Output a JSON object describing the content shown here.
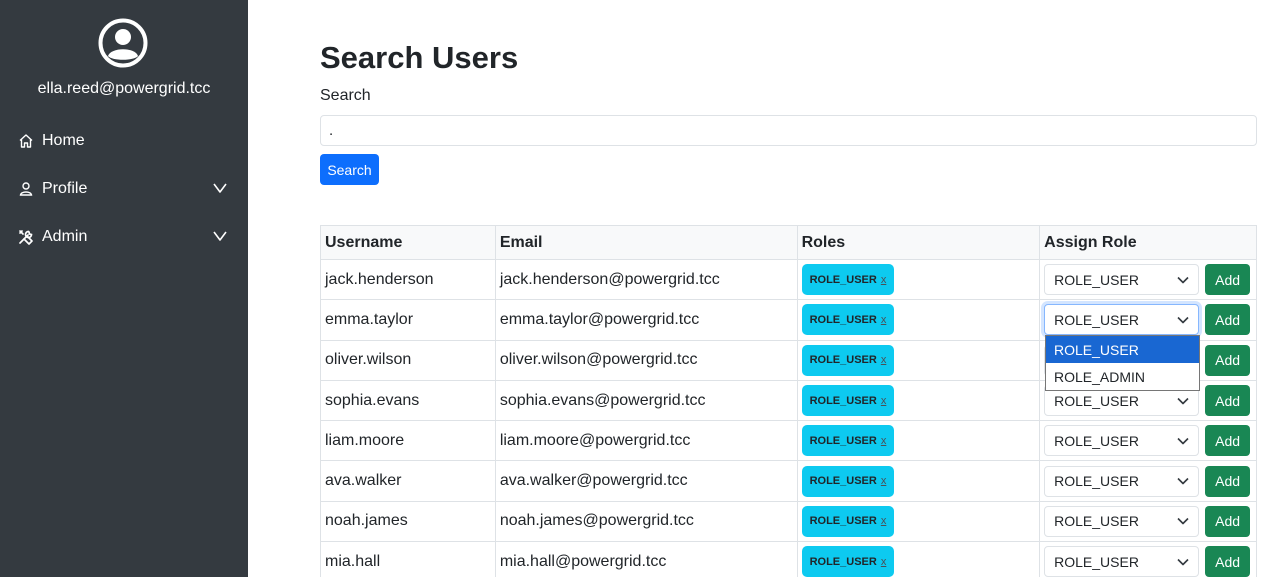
{
  "sidebar": {
    "user_email": "ella.reed@powergrid.tcc",
    "nav": [
      {
        "label": "Home",
        "icon": "home-icon"
      },
      {
        "label": "Profile",
        "icon": "person-icon"
      },
      {
        "label": "Admin",
        "icon": "tools-icon"
      }
    ]
  },
  "main": {
    "title": "Search Users",
    "search_label": "Search",
    "search_value": ".",
    "search_button": "Search"
  },
  "table": {
    "headers": [
      "Username",
      "Email",
      "Roles",
      "Assign Role"
    ],
    "rows": [
      {
        "username": "jack.henderson",
        "email": "jack.henderson@powergrid.tcc",
        "role": "ROLE_USER",
        "remove": "x",
        "select": "ROLE_USER",
        "add": "Add"
      },
      {
        "username": "emma.taylor",
        "email": "emma.taylor@powergrid.tcc",
        "role": "ROLE_USER",
        "remove": "x",
        "select": "ROLE_USER",
        "add": "Add"
      },
      {
        "username": "oliver.wilson",
        "email": "oliver.wilson@powergrid.tcc",
        "role": "ROLE_USER",
        "remove": "x",
        "select": "ROLE_USER",
        "add": "Add"
      },
      {
        "username": "sophia.evans",
        "email": "sophia.evans@powergrid.tcc",
        "role": "ROLE_USER",
        "remove": "x",
        "select": "ROLE_USER",
        "add": "Add"
      },
      {
        "username": "liam.moore",
        "email": "liam.moore@powergrid.tcc",
        "role": "ROLE_USER",
        "remove": "x",
        "select": "ROLE_USER",
        "add": "Add"
      },
      {
        "username": "ava.walker",
        "email": "ava.walker@powergrid.tcc",
        "role": "ROLE_USER",
        "remove": "x",
        "select": "ROLE_USER",
        "add": "Add"
      },
      {
        "username": "noah.james",
        "email": "noah.james@powergrid.tcc",
        "role": "ROLE_USER",
        "remove": "x",
        "select": "ROLE_USER",
        "add": "Add"
      },
      {
        "username": "mia.hall",
        "email": "mia.hall@powergrid.tcc",
        "role": "ROLE_USER",
        "remove": "x",
        "select": "ROLE_USER",
        "add": "Add"
      }
    ]
  },
  "dropdown": {
    "options": [
      "ROLE_USER",
      "ROLE_ADMIN"
    ],
    "selected": "ROLE_USER"
  },
  "colors": {
    "sidebar_bg": "#343a40",
    "primary": "#0d6efd",
    "badge": "#0dcaf0",
    "success": "#198754",
    "dropdown_highlight": "#1967d2"
  }
}
